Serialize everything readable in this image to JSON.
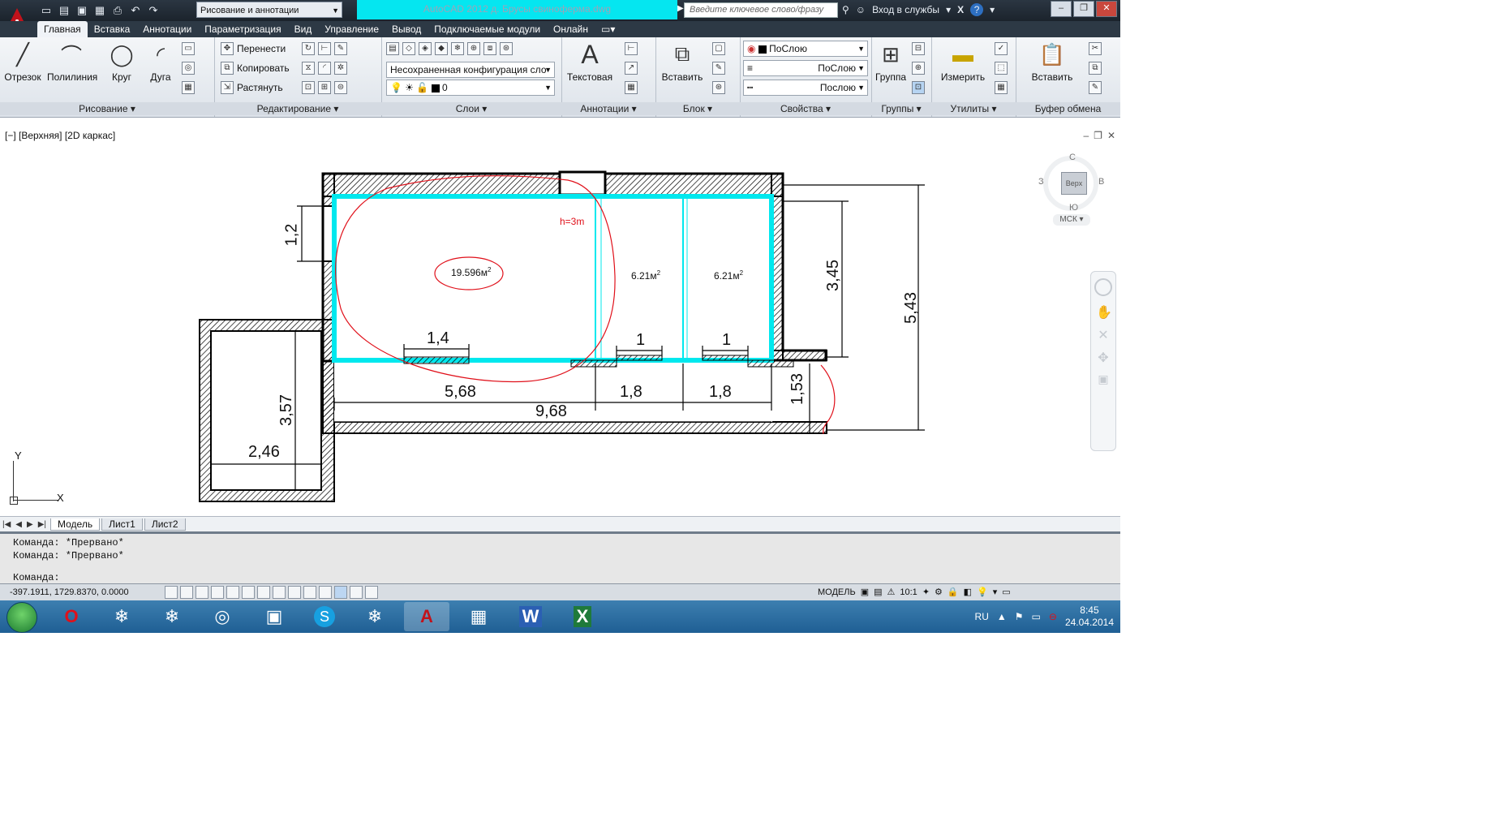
{
  "window": {
    "title": "AutoCAD 2012   д. Брусы свиноферма.dwg",
    "workspace": "Рисование и аннотации",
    "search_placeholder": "Введите ключевое слово/фразу",
    "signin": "Вход в службы"
  },
  "ribbon": {
    "tabs": [
      "Главная",
      "Вставка",
      "Аннотации",
      "Параметризация",
      "Вид",
      "Управление",
      "Вывод",
      "Подключаемые модули",
      "Онлайн"
    ],
    "draw": {
      "title": "Рисование",
      "line": "Отрезок",
      "polyline": "Полилиния",
      "circle": "Круг",
      "arc": "Дуга"
    },
    "modify": {
      "title": "Редактирование",
      "move": "Перенести",
      "copy": "Копировать",
      "stretch": "Растянуть"
    },
    "layers": {
      "title": "Слои",
      "state": "Несохраненная конфигурация сло",
      "current_layer": "0"
    },
    "annotation": {
      "title": "Аннотации",
      "text": "Текстовая"
    },
    "block": {
      "title": "Блок",
      "insert": "Вставить"
    },
    "properties": {
      "title": "Свойства",
      "color": "ПоСлою",
      "lineweight": "ПоСлою",
      "linetype": "Послою"
    },
    "groups": {
      "title": "Группы",
      "group": "Группа"
    },
    "utilities": {
      "title": "Утилиты",
      "measure": "Измерить"
    },
    "clipboard": {
      "title": "Буфер обмена",
      "paste": "Вставить"
    }
  },
  "viewport": {
    "label": "[−] [Верхняя] [2D каркас]",
    "viewcube": {
      "top": "Верх",
      "n": "С",
      "s": "Ю",
      "w": "З",
      "e": "В",
      "ucs": "МСК"
    },
    "ucs_x": "X",
    "ucs_y": "Y"
  },
  "drawing": {
    "height_note": "h=3m",
    "areas": [
      {
        "value": "19.596м",
        "sup": "2"
      },
      {
        "value": "6.21м",
        "sup": "2"
      },
      {
        "value": "6.21м",
        "sup": "2"
      }
    ],
    "dims": {
      "d_1_2": "1,2",
      "d_3_45": "3,45",
      "d_5_43": "5,43",
      "d_1_4": "1,4",
      "d_1_a": "1",
      "d_1_b": "1",
      "d_5_68": "5,68",
      "d_1_8_a": "1,8",
      "d_1_8_b": "1,8",
      "d_9_68": "9,68",
      "d_1_53": "1,53",
      "d_3_57": "3,57",
      "d_2_46": "2,46"
    }
  },
  "layout_tabs": [
    "Модель",
    "Лист1",
    "Лист2"
  ],
  "command": {
    "history": [
      "Команда: *Прервано*",
      "Команда: *Прервано*"
    ],
    "prompt": "Команда:"
  },
  "status": {
    "coords": "-397.1911, 1729.8370, 0.0000",
    "space": "МОДЕЛЬ",
    "scale": "10:1"
  },
  "taskbar": {
    "lang": "RU",
    "time": "8:45",
    "date": "24.04.2014"
  },
  "colors": {
    "wall": "#000000",
    "room_outline": "#00e8ee",
    "markup": "#e0101a",
    "accent_title": "#05e6f0"
  }
}
